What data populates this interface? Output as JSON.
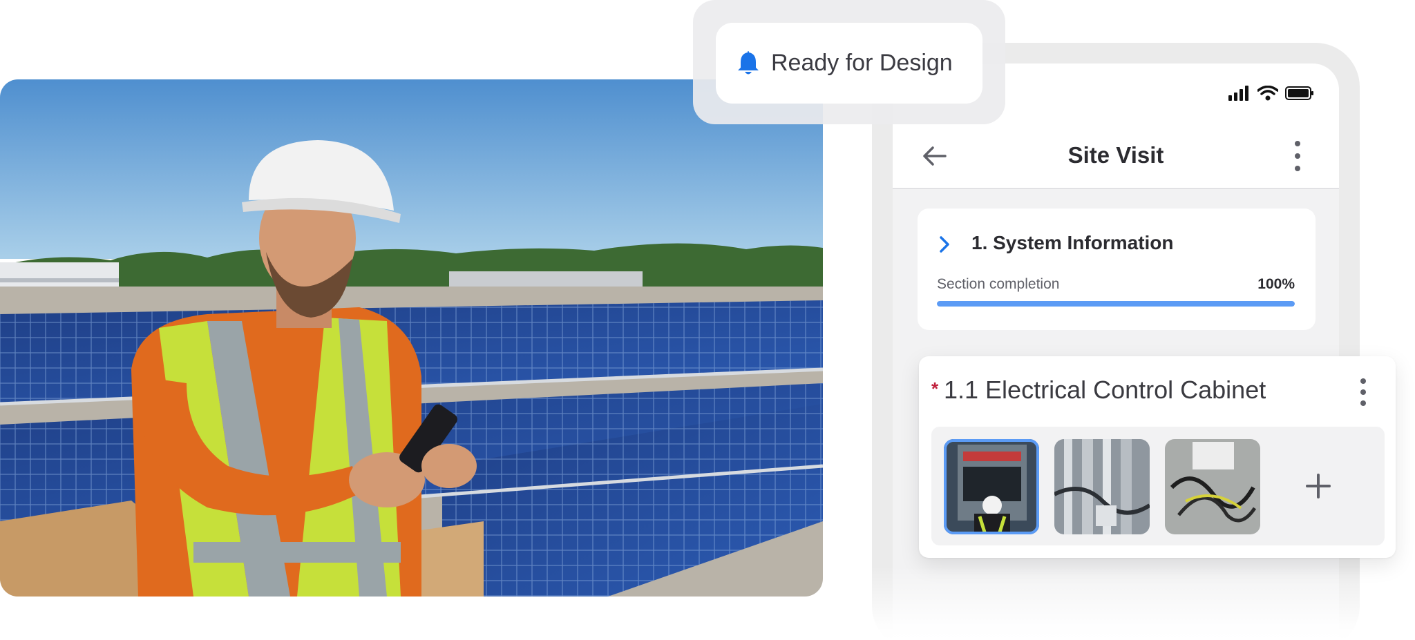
{
  "notification": {
    "text": "Ready for Design",
    "icon": "bell-icon",
    "icon_color": "#1a73e8"
  },
  "phone": {
    "status_icons": [
      "signal-icon",
      "wifi-icon",
      "battery-icon"
    ],
    "header": {
      "title": "Site Visit",
      "back_icon": "arrow-left-icon",
      "menu_icon": "more-vertical-icon"
    },
    "section": {
      "title": "1. System Information",
      "completion_label": "Section completion",
      "completion_value": "100%",
      "completion_fraction": 1.0,
      "accent": "#5b9bf5"
    }
  },
  "cabinet": {
    "required_mark": "*",
    "title": "1.1 Electrical Control Cabinet",
    "menu_icon": "more-vertical-icon",
    "add_icon": "plus-icon",
    "photos": [
      {
        "name": "cabinet-photo-1",
        "selected": true
      },
      {
        "name": "cabinet-photo-2",
        "selected": false
      },
      {
        "name": "cabinet-photo-3",
        "selected": false
      }
    ]
  },
  "colors": {
    "accent_blue": "#5b9bf5",
    "required_red": "#c0203c",
    "text_dark": "#2b2b30"
  }
}
